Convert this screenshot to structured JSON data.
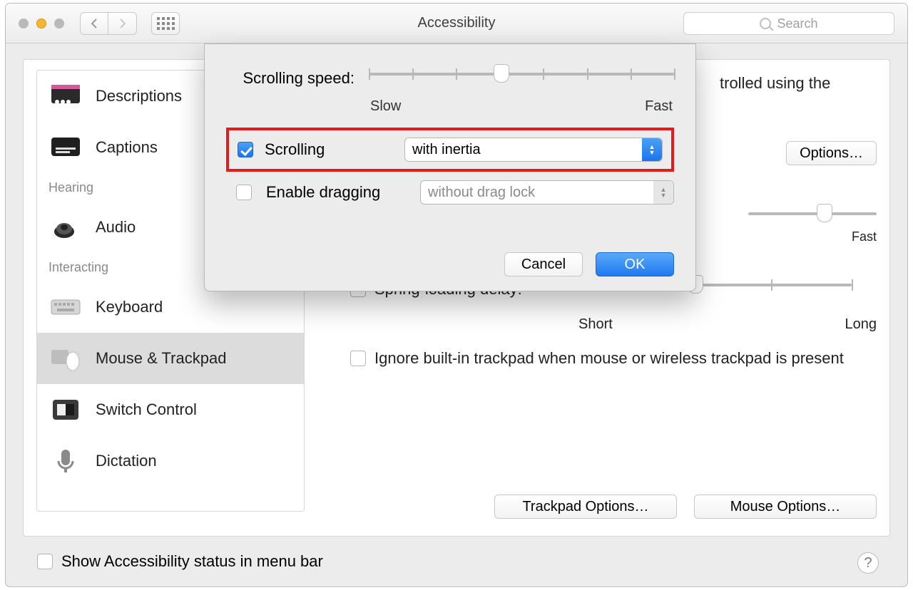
{
  "window": {
    "title": "Accessibility"
  },
  "search": {
    "placeholder": "Search"
  },
  "sidebar": {
    "head_hearing": "Hearing",
    "head_interacting": "Interacting",
    "items": {
      "descriptions": "Descriptions",
      "captions": "Captions",
      "audio": "Audio",
      "keyboard": "Keyboard",
      "mouse_trackpad": "Mouse & Trackpad",
      "switch_control": "Switch Control",
      "dictation": "Dictation"
    }
  },
  "main": {
    "desc_tail": "trolled using the",
    "options_button": "Options…",
    "second_slider": {
      "right": "Fast"
    },
    "spring_label": "Spring-loading delay:",
    "spring_left": "Short",
    "spring_right": "Long",
    "ignore_label": "Ignore built-in trackpad when mouse or wireless trackpad is present",
    "trackpad_options": "Trackpad Options…",
    "mouse_options": "Mouse Options…"
  },
  "sheet": {
    "scrolling_speed_label": "Scrolling speed:",
    "slow": "Slow",
    "fast": "Fast",
    "scrolling_label": "Scrolling",
    "scrolling_mode": "with inertia",
    "dragging_label": "Enable dragging",
    "dragging_mode": "without drag lock",
    "cancel": "Cancel",
    "ok": "OK"
  },
  "footer": {
    "show_status": "Show Accessibility status in menu bar"
  }
}
